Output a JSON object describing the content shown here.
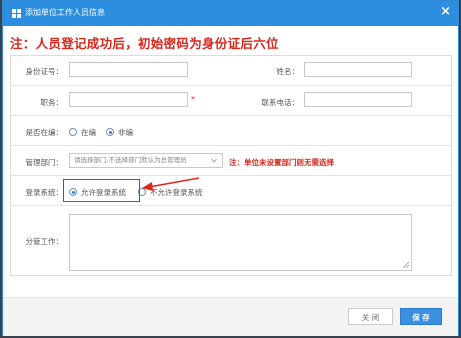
{
  "dialog": {
    "title": "添加单位工作人员信息",
    "close_glyph": "×",
    "notice": "注：人员登记成功后，初始密码为身份证后六位"
  },
  "form": {
    "id_card_label": "身份证号：",
    "name_label": "姓名：",
    "position_label": "职务：",
    "required_mark": "*",
    "phone_label": "联系电话：",
    "on_staff_label": "是否在编：",
    "on_staff_options": [
      "在编",
      "非编"
    ],
    "on_staff_selected": "非编",
    "dept_label": "管理部门：",
    "dept_placeholder": "请选择部门,不选择部门默认为总管理员",
    "dept_hint": "注：单位未设置部门则无需选择",
    "login_label": "登录系统：",
    "login_options": [
      "允许登录系统",
      "不允许登录系统"
    ],
    "login_selected": "允许登录系统",
    "duty_label": "分管工作："
  },
  "footer": {
    "close_label": "关 闭",
    "save_label": "保 存"
  },
  "colors": {
    "title_bar": "#2d8ee0",
    "accent_red": "#d8261c",
    "save_button": "#3a8fe0"
  },
  "icons": [
    "grid-icon",
    "close-icon",
    "chevron-down-icon",
    "resize-handle-icon",
    "annotation-arrow"
  ]
}
